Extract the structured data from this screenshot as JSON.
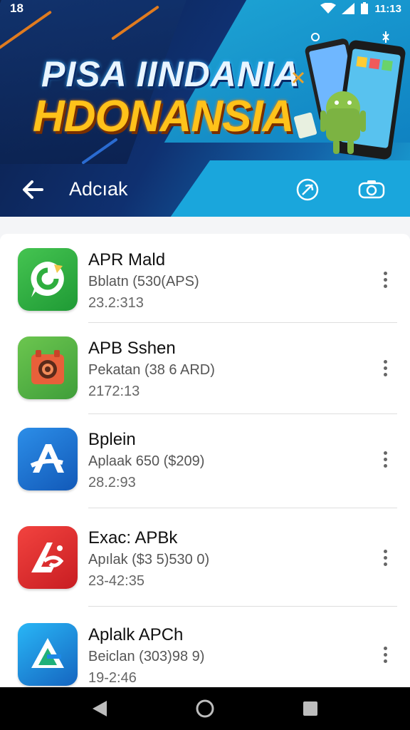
{
  "status_bar": {
    "time": "18",
    "right_text": "11:13"
  },
  "banner": {
    "title_line1": "PISA IINDANIA",
    "title_line2": "HDONANSIA"
  },
  "toolbar": {
    "title": "Adcıak"
  },
  "apps": [
    {
      "name": "APR Mald",
      "meta": "Bblatn (530(APS)",
      "date": "23.2:313",
      "icon": "chat-bubble-icon",
      "color": "#2fae3f"
    },
    {
      "name": "APB Sshen",
      "meta": "Pekatan (38 6 ARD)",
      "date": "2172:13",
      "icon": "camera-icon",
      "color": "#4cb548"
    },
    {
      "name": "Bplein",
      "meta": "Aplaak 650 ($209)",
      "date": "28.2:93",
      "icon": "a-logo-icon",
      "color": "#1976d2"
    },
    {
      "name": "Exac: APBk",
      "meta": "Apılak ($3 5)530 0)",
      "date": "23-42:35",
      "icon": "adobe-like-icon",
      "color": "#e53935"
    },
    {
      "name": "Aplalk APCh",
      "meta": "Beiclan (303)98 9)",
      "date": "19-2:46",
      "icon": "arrow-triangle-icon",
      "color": "#1fa0e0"
    }
  ],
  "colors": {
    "banner_dark": "#0b1f4a",
    "banner_cyan": "#19a3d6",
    "title_yellow": "#ffc21a"
  }
}
